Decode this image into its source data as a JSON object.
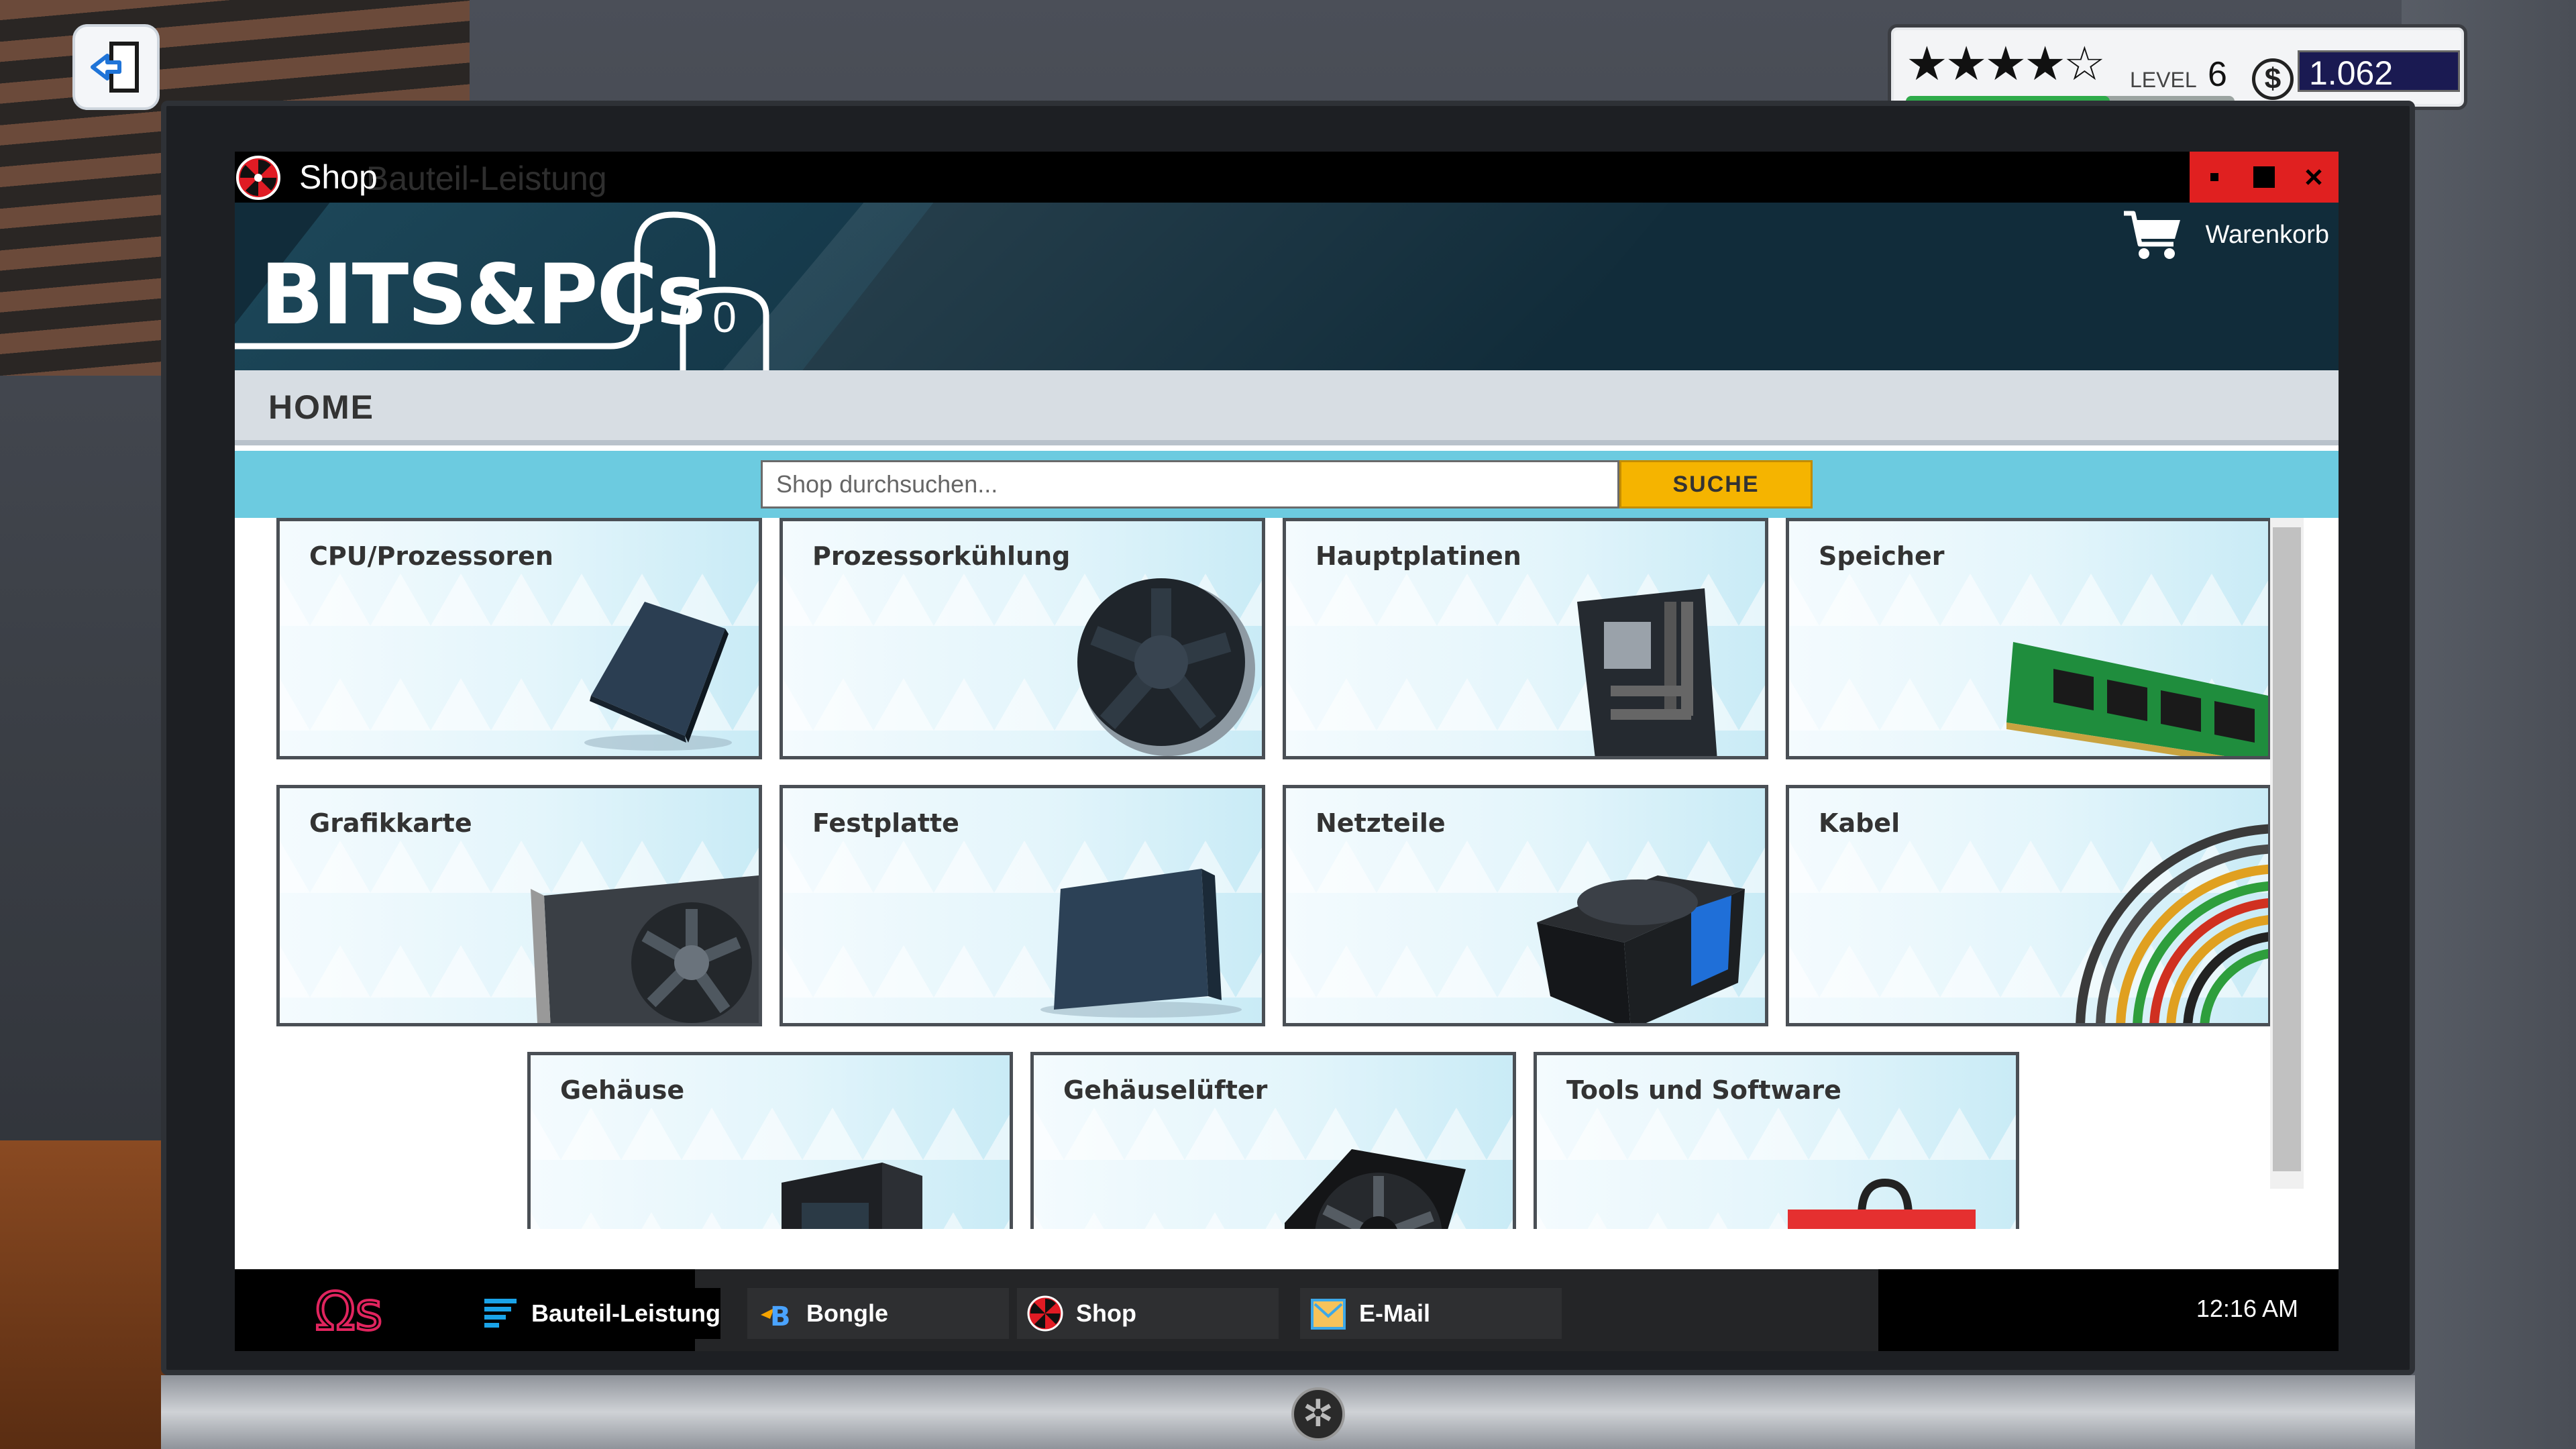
{
  "hud": {
    "stars": "★★★★☆",
    "rating": 4,
    "level_label": "LEVEL",
    "level": "6",
    "xp_progress": 0.62,
    "currency_icon": "$",
    "money": "1.062"
  },
  "window": {
    "title": "Shop",
    "ghost_title": "Bauteil-Leistung"
  },
  "shop": {
    "logo": "BITS&PCs",
    "cart_count": "0",
    "cart_label": "Warenkorb"
  },
  "nav": {
    "home": "HOME"
  },
  "search": {
    "placeholder": "Shop durchsuchen...",
    "button": "SUCHE"
  },
  "categories": [
    {
      "label": "CPU/Prozessoren",
      "icon": "cpu-icon"
    },
    {
      "label": "Prozessorkühlung",
      "icon": "cpu-cooler-icon"
    },
    {
      "label": "Hauptplatinen",
      "icon": "motherboard-icon"
    },
    {
      "label": "Speicher",
      "icon": "ram-icon"
    },
    {
      "label": "Grafikkarte",
      "icon": "graphics-card-icon"
    },
    {
      "label": "Festplatte",
      "icon": "hard-drive-icon"
    },
    {
      "label": "Netzteile",
      "icon": "power-supply-icon"
    },
    {
      "label": "Kabel",
      "icon": "cables-icon"
    },
    {
      "label": "Gehäuse",
      "icon": "case-icon"
    },
    {
      "label": "Gehäuselüfter",
      "icon": "case-fan-icon"
    },
    {
      "label": "Tools und Software",
      "icon": "toolbox-icon"
    }
  ],
  "taskbar": {
    "os_logo": "Ωs",
    "items": [
      {
        "label": "Bauteil-Leistung",
        "icon": "benchmark-icon"
      },
      {
        "label": "Bongle",
        "icon": "browser-icon"
      },
      {
        "label": "Shop",
        "icon": "shop-icon"
      },
      {
        "label": "E-Mail",
        "icon": "email-icon"
      }
    ],
    "clock": "12:16 AM"
  },
  "colors": {
    "accent_yellow": "#f5b400",
    "search_band": "#6ccbe0",
    "header_navy": "#112c3a",
    "window_controls_red": "#e02020"
  }
}
